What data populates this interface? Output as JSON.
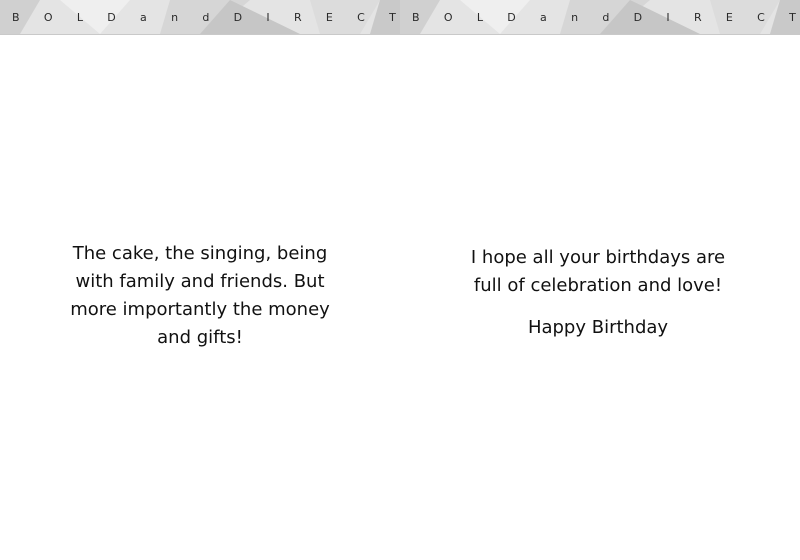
{
  "banner": {
    "left_letters": [
      "B",
      "O",
      "L",
      "D",
      "a",
      "n",
      "d",
      "D",
      "I",
      "R",
      "E",
      "C",
      "T"
    ],
    "right_letters": [
      "B",
      "O",
      "L",
      "D",
      "a",
      "n",
      "d",
      "D",
      "I",
      "R",
      "E",
      "C",
      "T"
    ],
    "colors": {
      "light": "#e6e6e6",
      "mid": "#d2d2d2",
      "dark": "#bdbdbd"
    }
  },
  "left_panel": {
    "message": "The cake, the singing, being\nwith family and friends.  But\nmore importantly the money\nand gifts!"
  },
  "right_panel": {
    "message": "I hope all your birthdays are\nfull of celebration and love!",
    "signoff": "Happy Birthday"
  }
}
